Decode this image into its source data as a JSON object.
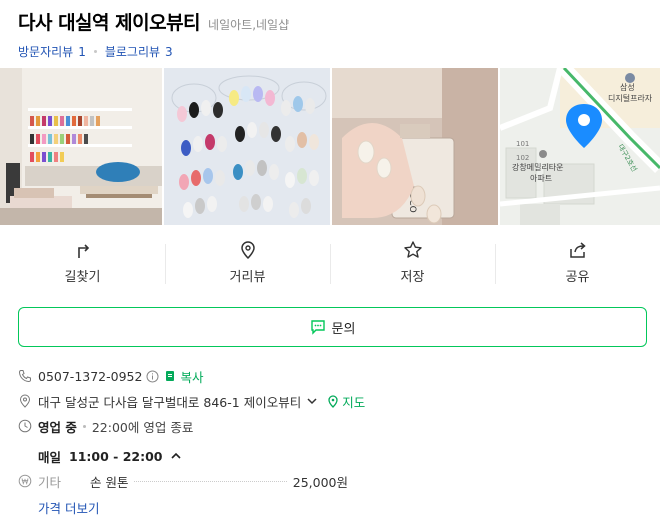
{
  "place": {
    "name": "다사 대실역 제이오뷰티",
    "category": "네일아트,네일샵",
    "visitor_review_label": "방문자리뷰",
    "visitor_review_count": "1",
    "blog_review_label": "블로그리뷰",
    "blog_review_count": "3"
  },
  "map_thumb": {
    "label_top": "삼성",
    "label_top2": "디지털프라자",
    "road": "대구2호선",
    "apartment": "강창메밀리타운",
    "apartment2": "아파트",
    "num1": "101",
    "num2": "102"
  },
  "actions": [
    {
      "label": "길찾기",
      "icon": "directions-icon"
    },
    {
      "label": "거리뷰",
      "icon": "street-view-icon"
    },
    {
      "label": "저장",
      "icon": "star-icon"
    },
    {
      "label": "공유",
      "icon": "share-icon"
    }
  ],
  "inquiry_label": "문의",
  "info": {
    "phone": "0507-1372-0952",
    "copy_label": "복사",
    "address": "대구 달성군 다사읍 달구벌대로 846-1 제이오뷰티",
    "map_label": "지도",
    "status": "영업 중",
    "closing": "22:00에 영업 종료",
    "day": "매일",
    "hours": "11:00 - 22:00",
    "price_category": "기타",
    "price_item": "손 원톤",
    "price_value": "25,000원",
    "more_price": "가격 더보기"
  },
  "colors": {
    "accent": "#03c75a",
    "link": "#2254b4",
    "pin": "#1a8cff"
  }
}
